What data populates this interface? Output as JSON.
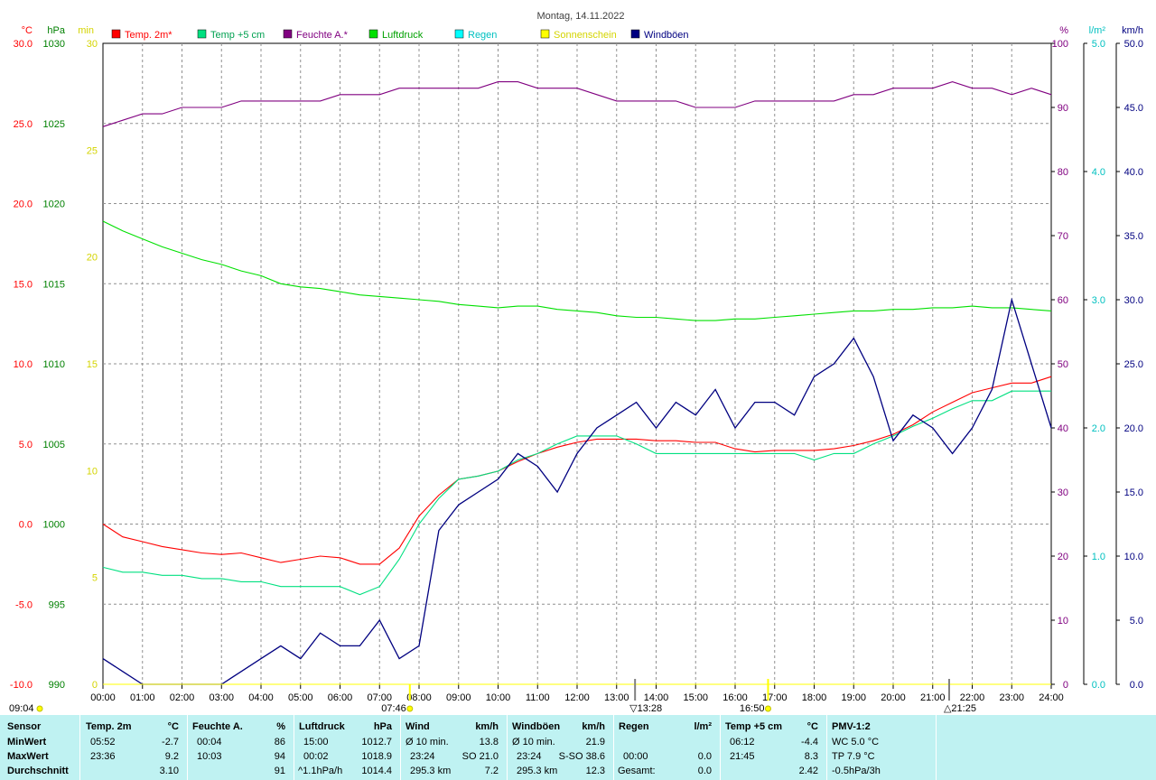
{
  "title": "Montag, 14.11.2022",
  "colors": {
    "temp2m": "#ff0000",
    "temp5cm": "#00e080",
    "feuchte": "#800080",
    "luftdruck": "#00e000",
    "regen": "#00ffff",
    "sonnenschein": "#ffff00",
    "windboeen": "#000080"
  },
  "axes": {
    "temp": {
      "unit": "°C",
      "ticks": [
        "30.0",
        "25.0",
        "20.0",
        "15.0",
        "10.0",
        "5.0",
        "0.0",
        "-5.0",
        "-10.0"
      ],
      "range": [
        -10,
        30
      ],
      "color": "#ff0000"
    },
    "hpa": {
      "unit": "hPa",
      "ticks": [
        "1030",
        "1025",
        "1020",
        "1015",
        "1010",
        "1005",
        "1000",
        "995",
        "990"
      ],
      "range": [
        990,
        1030
      ],
      "color": "#008000"
    },
    "min": {
      "unit": "min",
      "ticks": [
        "30",
        "25",
        "20",
        "15",
        "10",
        "5",
        "0"
      ],
      "range": [
        0,
        30
      ],
      "color": "#e0e000"
    },
    "pct": {
      "unit": "%",
      "ticks": [
        "100",
        "90",
        "80",
        "70",
        "60",
        "50",
        "40",
        "30",
        "20",
        "10",
        "0"
      ],
      "range": [
        0,
        100
      ],
      "color": "#800080"
    },
    "lm2": {
      "unit": "l/m²",
      "ticks": [
        "5.0",
        "4.0",
        "3.0",
        "2.0",
        "1.0",
        "0.0"
      ],
      "range": [
        0,
        5
      ],
      "color": "#00c0c0"
    },
    "kmh": {
      "unit": "km/h",
      "ticks": [
        "50.0",
        "45.0",
        "40.0",
        "35.0",
        "30.0",
        "25.0",
        "20.0",
        "15.0",
        "10.0",
        "5.0",
        "0.0"
      ],
      "range": [
        0,
        50
      ],
      "color": "#000080"
    },
    "x_ticks": [
      "00:00",
      "01:00",
      "02:00",
      "03:00",
      "04:00",
      "05:00",
      "06:00",
      "07:00",
      "08:00",
      "09:00",
      "10:00",
      "11:00",
      "12:00",
      "13:00",
      "14:00",
      "15:00",
      "16:00",
      "17:00",
      "18:00",
      "19:00",
      "20:00",
      "21:00",
      "22:00",
      "23:00",
      "24:00"
    ]
  },
  "legend": [
    "Temp. 2m*",
    "Temp +5 cm",
    "Feuchte A.*",
    "Luftdruck",
    "Regen",
    "Sonnenschein",
    "Windböen"
  ],
  "markers": {
    "sunrise": "07:46",
    "sunset": "16:50",
    "moon_max": "13:28",
    "moon_rise": "21:25",
    "sunshine_total": "09:04"
  },
  "chart_data": {
    "type": "line",
    "title": "Montag, 14.11.2022",
    "x_hours": [
      0,
      0.5,
      1,
      1.5,
      2,
      2.5,
      3,
      3.5,
      4,
      4.5,
      5,
      5.5,
      6,
      6.5,
      7,
      7.5,
      8,
      8.5,
      9,
      9.5,
      10,
      10.5,
      11,
      11.5,
      12,
      12.5,
      13,
      13.5,
      14,
      14.5,
      15,
      15.5,
      16,
      16.5,
      17,
      17.5,
      18,
      18.5,
      19,
      19.5,
      20,
      20.5,
      21,
      21.5,
      22,
      22.5,
      23,
      23.5,
      24
    ],
    "series": [
      {
        "name": "Temp. 2m*",
        "axis": "temp",
        "values": [
          0.0,
          -0.8,
          -1.1,
          -1.4,
          -1.6,
          -1.8,
          -1.9,
          -1.8,
          -2.1,
          -2.4,
          -2.2,
          -2.0,
          -2.1,
          -2.5,
          -2.5,
          -1.5,
          0.5,
          1.8,
          2.8,
          3.0,
          3.3,
          3.9,
          4.4,
          4.8,
          5.1,
          5.3,
          5.3,
          5.3,
          5.2,
          5.2,
          5.1,
          5.1,
          4.7,
          4.5,
          4.6,
          4.6,
          4.6,
          4.7,
          4.9,
          5.2,
          5.6,
          6.2,
          7.0,
          7.6,
          8.2,
          8.5,
          8.8,
          8.8,
          9.2
        ]
      },
      {
        "name": "Temp +5 cm",
        "axis": "temp",
        "values": [
          -2.7,
          -3.0,
          -3.0,
          -3.2,
          -3.2,
          -3.4,
          -3.4,
          -3.6,
          -3.6,
          -3.9,
          -3.9,
          -3.9,
          -3.9,
          -4.4,
          -3.9,
          -2.2,
          0.0,
          1.6,
          2.8,
          3.0,
          3.3,
          4.0,
          4.4,
          5.0,
          5.5,
          5.5,
          5.5,
          5.0,
          4.4,
          4.4,
          4.4,
          4.4,
          4.4,
          4.4,
          4.4,
          4.4,
          4.0,
          4.4,
          4.4,
          5.0,
          5.5,
          6.1,
          6.6,
          7.2,
          7.7,
          7.7,
          8.3,
          8.3,
          8.3
        ]
      },
      {
        "name": "Feuchte A.*",
        "axis": "pct",
        "values": [
          87,
          88,
          89,
          89,
          90,
          90,
          90,
          91,
          91,
          91,
          91,
          91,
          92,
          92,
          92,
          93,
          93,
          93,
          93,
          93,
          94,
          94,
          93,
          93,
          93,
          92,
          91,
          91,
          91,
          91,
          90,
          90,
          90,
          91,
          91,
          91,
          91,
          91,
          92,
          92,
          93,
          93,
          93,
          94,
          93,
          93,
          92,
          93,
          92
        ]
      },
      {
        "name": "Luftdruck",
        "axis": "hpa",
        "values": [
          1018.9,
          1018.3,
          1017.8,
          1017.3,
          1016.9,
          1016.5,
          1016.2,
          1015.8,
          1015.5,
          1015.0,
          1014.8,
          1014.7,
          1014.5,
          1014.3,
          1014.2,
          1014.1,
          1014.0,
          1013.9,
          1013.7,
          1013.6,
          1013.5,
          1013.6,
          1013.6,
          1013.4,
          1013.3,
          1013.2,
          1013.0,
          1012.9,
          1012.9,
          1012.8,
          1012.7,
          1012.7,
          1012.8,
          1012.8,
          1012.9,
          1013.0,
          1013.1,
          1013.2,
          1013.3,
          1013.3,
          1013.4,
          1013.4,
          1013.5,
          1013.5,
          1013.6,
          1013.5,
          1013.5,
          1013.4,
          1013.3
        ]
      },
      {
        "name": "Windböen",
        "axis": "kmh",
        "values": [
          2,
          1,
          0,
          0,
          0,
          0,
          0,
          1,
          2,
          3,
          2,
          4,
          3,
          3,
          5,
          2,
          3,
          12,
          14,
          15,
          16,
          18,
          17,
          15,
          18,
          20,
          21,
          22,
          20,
          22,
          21,
          23,
          20,
          22,
          22,
          21,
          24,
          25,
          27,
          24,
          19,
          21,
          20,
          18,
          20,
          23,
          30,
          25,
          20
        ]
      },
      {
        "name": "Regen",
        "axis": "lm2",
        "values": [
          0,
          0,
          0,
          0,
          0,
          0,
          0,
          0,
          0,
          0,
          0,
          0,
          0,
          0,
          0,
          0,
          0,
          0,
          0,
          0,
          0,
          0,
          0,
          0,
          0,
          0,
          0,
          0,
          0,
          0,
          0,
          0,
          0,
          0,
          0,
          0,
          0,
          0,
          0,
          0,
          0,
          0,
          0,
          0,
          0,
          0,
          0,
          0,
          0
        ]
      },
      {
        "name": "Sonnenschein",
        "axis": "min",
        "values": [
          0,
          0,
          0,
          0,
          0,
          0,
          0,
          0,
          0,
          0,
          0,
          0,
          0,
          0,
          0,
          0,
          0,
          0,
          0,
          0,
          0,
          0,
          0,
          0,
          0,
          0,
          0,
          0,
          0,
          0,
          0,
          0,
          0,
          0,
          0,
          0,
          0,
          0,
          0,
          0,
          0,
          0,
          0,
          0,
          0,
          0,
          0,
          0,
          0
        ]
      }
    ]
  },
  "table": {
    "row_labels": [
      "Sensor",
      "MinWert",
      "MaxWert",
      "Durchschnitt"
    ],
    "temp2m": {
      "name": "Temp. 2m",
      "unit": "°C",
      "min_time": "05:52",
      "min": "-2.7",
      "max_time": "23:36",
      "max": "9.2",
      "avg": "3.10"
    },
    "feuchte": {
      "name": "Feuchte A.",
      "unit": "%",
      "min_time": "00:04",
      "min": "86",
      "max_time": "10:03",
      "max": "94",
      "avg": "91"
    },
    "luftdruck": {
      "name": "Luftdruck",
      "unit": "hPa",
      "min_time": "15:00",
      "min": "1012.7",
      "max_time": "00:02",
      "max": "1018.9",
      "trend": "^1.1hPa/h",
      "avg": "1014.4"
    },
    "wind": {
      "name": "Wind",
      "unit": "km/h",
      "avg_label": "Ø 10 min.",
      "avg": "13.8",
      "max_time": "23:24",
      "max_dir": "SO 21.0",
      "dist": "295.3 km",
      "dist_val": "7.2"
    },
    "windboeen": {
      "name": "Windböen",
      "unit": "km/h",
      "avg_label": "Ø 10 min.",
      "avg": "21.9",
      "max_time": "23:24",
      "max_dir": "S-SO 38.6",
      "dist": "295.3 km",
      "dist_val": "12.3"
    },
    "regen": {
      "name": "Regen",
      "unit": "l/m²",
      "time": "00:00",
      "val": "0.0",
      "total_label": "Gesamt:",
      "total": "0.0"
    },
    "temp5cm": {
      "name": "Temp +5 cm",
      "unit": "°C",
      "min_time": "06:12",
      "min": "-4.4",
      "max_time": "21:45",
      "max": "8.3",
      "avg": "2.42"
    },
    "pmv": {
      "name": "PMV-1:2",
      "wc": "WC 5.0 °C",
      "tp": "TP 7.9 °C",
      "trend": "-0.5hPa/3h"
    }
  }
}
